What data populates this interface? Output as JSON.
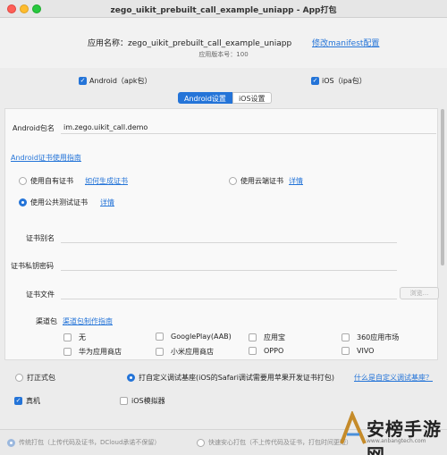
{
  "window": {
    "title": "zego_uikit_prebuilt_call_example_uniapp - App打包"
  },
  "header": {
    "app_name_label": "应用名称：",
    "app_name": "zego_uikit_prebuilt_call_example_uniapp",
    "version_label": "应用版本号：100",
    "modify_manifest": "修改manifest配置"
  },
  "platforms": {
    "android": {
      "label": "Android（apk包）",
      "checked": true
    },
    "ios": {
      "label": "iOS（ipa包）",
      "checked": true
    }
  },
  "tabs": [
    {
      "label": "Android设置",
      "active": true
    },
    {
      "label": "iOS设置",
      "active": false
    }
  ],
  "android": {
    "package_label": "Android包名",
    "package_value": "im.zego.uikit_call.demo",
    "cert_guide": "Android证书使用指南",
    "cert_options": {
      "own": "使用自有证书",
      "own_help": "如何生成证书",
      "cloud": "使用云端证书",
      "cloud_detail": "详情",
      "public_test": "使用公共测试证书",
      "public_detail": "详情"
    },
    "alias_label": "证书别名",
    "password_label": "证书私钥密码",
    "file_label": "证书文件",
    "browse": "浏览..."
  },
  "channels": {
    "label": "渠道包",
    "guide": "渠道包制作指南",
    "items": [
      "无",
      "GooglePlay(AAB)",
      "应用宝",
      "360应用市场",
      "华为应用商店",
      "小米应用商店",
      "OPPO",
      "VIVO"
    ]
  },
  "build_mode": {
    "formal": "打正式包",
    "custom": "打自定义调试基座(iOS的Safari调试需要用苹果开发证书打包)",
    "what_is": "什么是自定义调试基座？"
  },
  "devices": {
    "real": "真机",
    "simulator": "iOS模拟器"
  },
  "bottom": {
    "traditional": "传统打包（上传代码及证书，DCloud承诺不保留）",
    "fast": "快速安心打包（不上传代码及证书，打包时间更短）"
  },
  "watermark": {
    "text": "安榜手游网",
    "url": "www.anbangtech.com"
  }
}
